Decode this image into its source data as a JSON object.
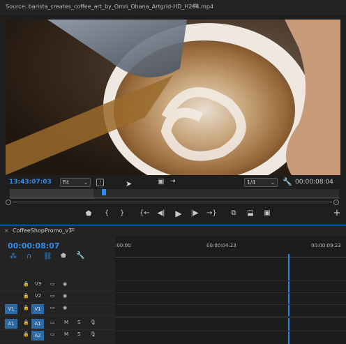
{
  "source": {
    "title": "Source: barista_creates_coffee_art_by_Omri_Ohana_Artgrid-HD_H264.mp4",
    "menu_icon": "hamburger-icon"
  },
  "monitor": {
    "timecode_current": "13:43:07:03",
    "fit_value": "Fit",
    "resolution_value": "1/4",
    "duration": "00:00:08:04",
    "playhead_fraction": 0.28
  },
  "timeline": {
    "close_label": "×",
    "tab_label": "CoffeeShopPromo_v1",
    "timecode": "00:00:08:07",
    "ruler_labels": [
      ":00:00",
      "00:00:04:23",
      "00:00:09:23"
    ],
    "playhead_fraction": 0.75,
    "video_tracks": [
      {
        "name": "V3",
        "patch": ""
      },
      {
        "name": "V2",
        "patch": ""
      },
      {
        "name": "V1",
        "patch": "V1"
      }
    ],
    "audio_tracks": [
      {
        "name": "A1",
        "patch": "A1",
        "m": "M",
        "s": "S"
      },
      {
        "name": "A2",
        "patch": "",
        "m": "M",
        "s": "S"
      }
    ]
  },
  "colors": {
    "accent": "#2d8ceb",
    "patch": "#2d6aa8"
  }
}
